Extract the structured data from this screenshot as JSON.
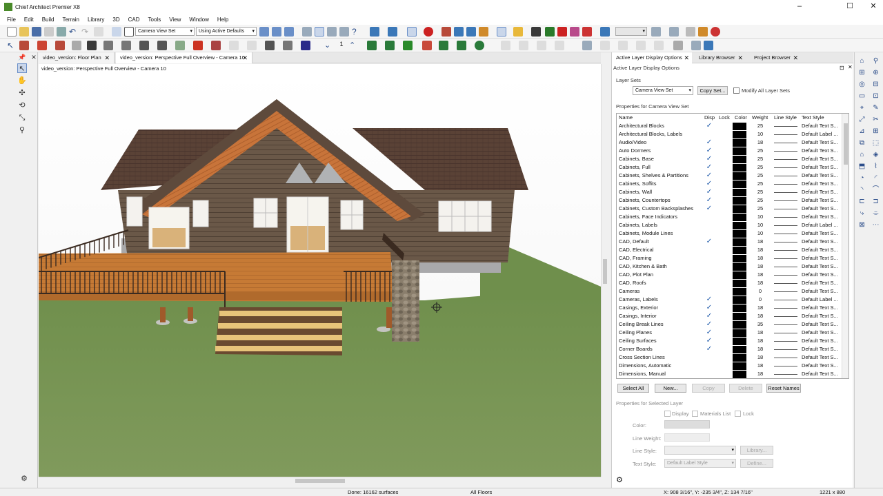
{
  "window": {
    "title": "Chief Architect Premier X8"
  },
  "menu": [
    "File",
    "Edit",
    "Build",
    "Terrain",
    "Library",
    "3D",
    "CAD",
    "Tools",
    "View",
    "Window",
    "Help"
  ],
  "toolbar": {
    "layer_set_combo": "Camera View Set",
    "defaults_combo": "Using Active Defaults",
    "step": "1"
  },
  "doc_tabs": [
    {
      "label": "video_version: Floor Plan"
    },
    {
      "label": "video_version: Perspective Full Overview - Camera 10"
    }
  ],
  "view_title": "video_version: Perspective Full Overview - Camera 10",
  "panel": {
    "tabs": [
      "Active Layer Display Options",
      "Library Browser",
      "Project Browser"
    ],
    "title": "Active Layer Display Options",
    "layer_sets_label": "Layer Sets",
    "layer_set_value": "Camera View Set",
    "copy_set_btn": "Copy Set...",
    "modify_all": "Modify All Layer Sets",
    "properties_label": "Properties for Camera View Set",
    "columns": [
      "Name",
      "Disp",
      "Lock",
      "Color",
      "Weight",
      "Line Style",
      "Text Style"
    ],
    "layers": [
      {
        "name": "Architectural Blocks",
        "disp": true,
        "weight": "25",
        "text": "Default Text S..."
      },
      {
        "name": "Architectural Blocks, Labels",
        "disp": false,
        "weight": "10",
        "text": "Default Label ..."
      },
      {
        "name": "Audio/Video",
        "disp": true,
        "weight": "18",
        "text": "Default Text S..."
      },
      {
        "name": "Auto Dormers",
        "disp": true,
        "weight": "25",
        "text": "Default Text S..."
      },
      {
        "name": "Cabinets,  Base",
        "disp": true,
        "weight": "25",
        "text": "Default Text S..."
      },
      {
        "name": "Cabinets,  Full",
        "disp": true,
        "weight": "25",
        "text": "Default Text S..."
      },
      {
        "name": "Cabinets,  Shelves & Partitions",
        "disp": true,
        "weight": "25",
        "text": "Default Text S..."
      },
      {
        "name": "Cabinets,  Soffits",
        "disp": true,
        "weight": "25",
        "text": "Default Text S..."
      },
      {
        "name": "Cabinets,  Wall",
        "disp": true,
        "weight": "25",
        "text": "Default Text S..."
      },
      {
        "name": "Cabinets, Countertops",
        "disp": true,
        "weight": "25",
        "text": "Default Text S..."
      },
      {
        "name": "Cabinets, Custom Backsplashes",
        "disp": true,
        "weight": "25",
        "text": "Default Text S..."
      },
      {
        "name": "Cabinets, Face Indicators",
        "disp": false,
        "weight": "10",
        "text": "Default Text S..."
      },
      {
        "name": "Cabinets, Labels",
        "disp": false,
        "weight": "10",
        "text": "Default Label ..."
      },
      {
        "name": "Cabinets, Module Lines",
        "disp": false,
        "weight": "10",
        "text": "Default Text S..."
      },
      {
        "name": "CAD,  Default",
        "disp": true,
        "weight": "18",
        "text": "Default Text S..."
      },
      {
        "name": "CAD, Electrical",
        "disp": false,
        "weight": "18",
        "text": "Default Text S..."
      },
      {
        "name": "CAD, Framing",
        "disp": false,
        "weight": "18",
        "text": "Default Text S..."
      },
      {
        "name": "CAD, Kitchen & Bath",
        "disp": false,
        "weight": "18",
        "text": "Default Text S..."
      },
      {
        "name": "CAD, Plot Plan",
        "disp": false,
        "weight": "18",
        "text": "Default Text S..."
      },
      {
        "name": "CAD, Roofs",
        "disp": false,
        "weight": "18",
        "text": "Default Text S..."
      },
      {
        "name": "Cameras",
        "disp": false,
        "weight": "0",
        "text": "Default Text S..."
      },
      {
        "name": "Cameras, Labels",
        "disp": true,
        "weight": "0",
        "text": "Default Label ..."
      },
      {
        "name": "Casings, Exterior",
        "disp": true,
        "weight": "18",
        "text": "Default Text S..."
      },
      {
        "name": "Casings, Interior",
        "disp": true,
        "weight": "18",
        "text": "Default Text S..."
      },
      {
        "name": "Ceiling Break Lines",
        "disp": true,
        "weight": "35",
        "text": "Default Text S..."
      },
      {
        "name": "Ceiling Planes",
        "disp": true,
        "weight": "18",
        "text": "Default Text S..."
      },
      {
        "name": "Ceiling Surfaces",
        "disp": true,
        "weight": "18",
        "text": "Default Text S..."
      },
      {
        "name": "Corner Boards",
        "disp": true,
        "weight": "18",
        "text": "Default Text S..."
      },
      {
        "name": "Cross Section Lines",
        "disp": false,
        "weight": "18",
        "text": "Default Text S..."
      },
      {
        "name": "Dimensions,  Automatic",
        "disp": false,
        "weight": "18",
        "text": "Default Text S..."
      },
      {
        "name": "Dimensions,  Manual",
        "disp": false,
        "weight": "18",
        "text": "Default Text S..."
      }
    ],
    "buttons": {
      "select_all": "Select All",
      "new": "New...",
      "copy": "Copy",
      "delete": "Delete",
      "reset_names": "Reset Names"
    },
    "selected_label": "Properties for Selected Layer",
    "sel_display": "Display",
    "sel_materials": "Materials List",
    "sel_lock": "Lock",
    "color_label": "Color:",
    "line_weight_label": "Line Weight:",
    "line_style_label": "Line Style:",
    "text_style_label": "Text Style:",
    "text_style_value": "Default Label Style",
    "library_btn": "Library...",
    "define_btn": "Define..."
  },
  "status": {
    "message": "Done:  16162 surfaces",
    "floors": "All Floors",
    "coords": "X: 908 3/16\", Y: -235 3/4\", Z: 134 7/16\"",
    "size": "1221 x 880"
  }
}
